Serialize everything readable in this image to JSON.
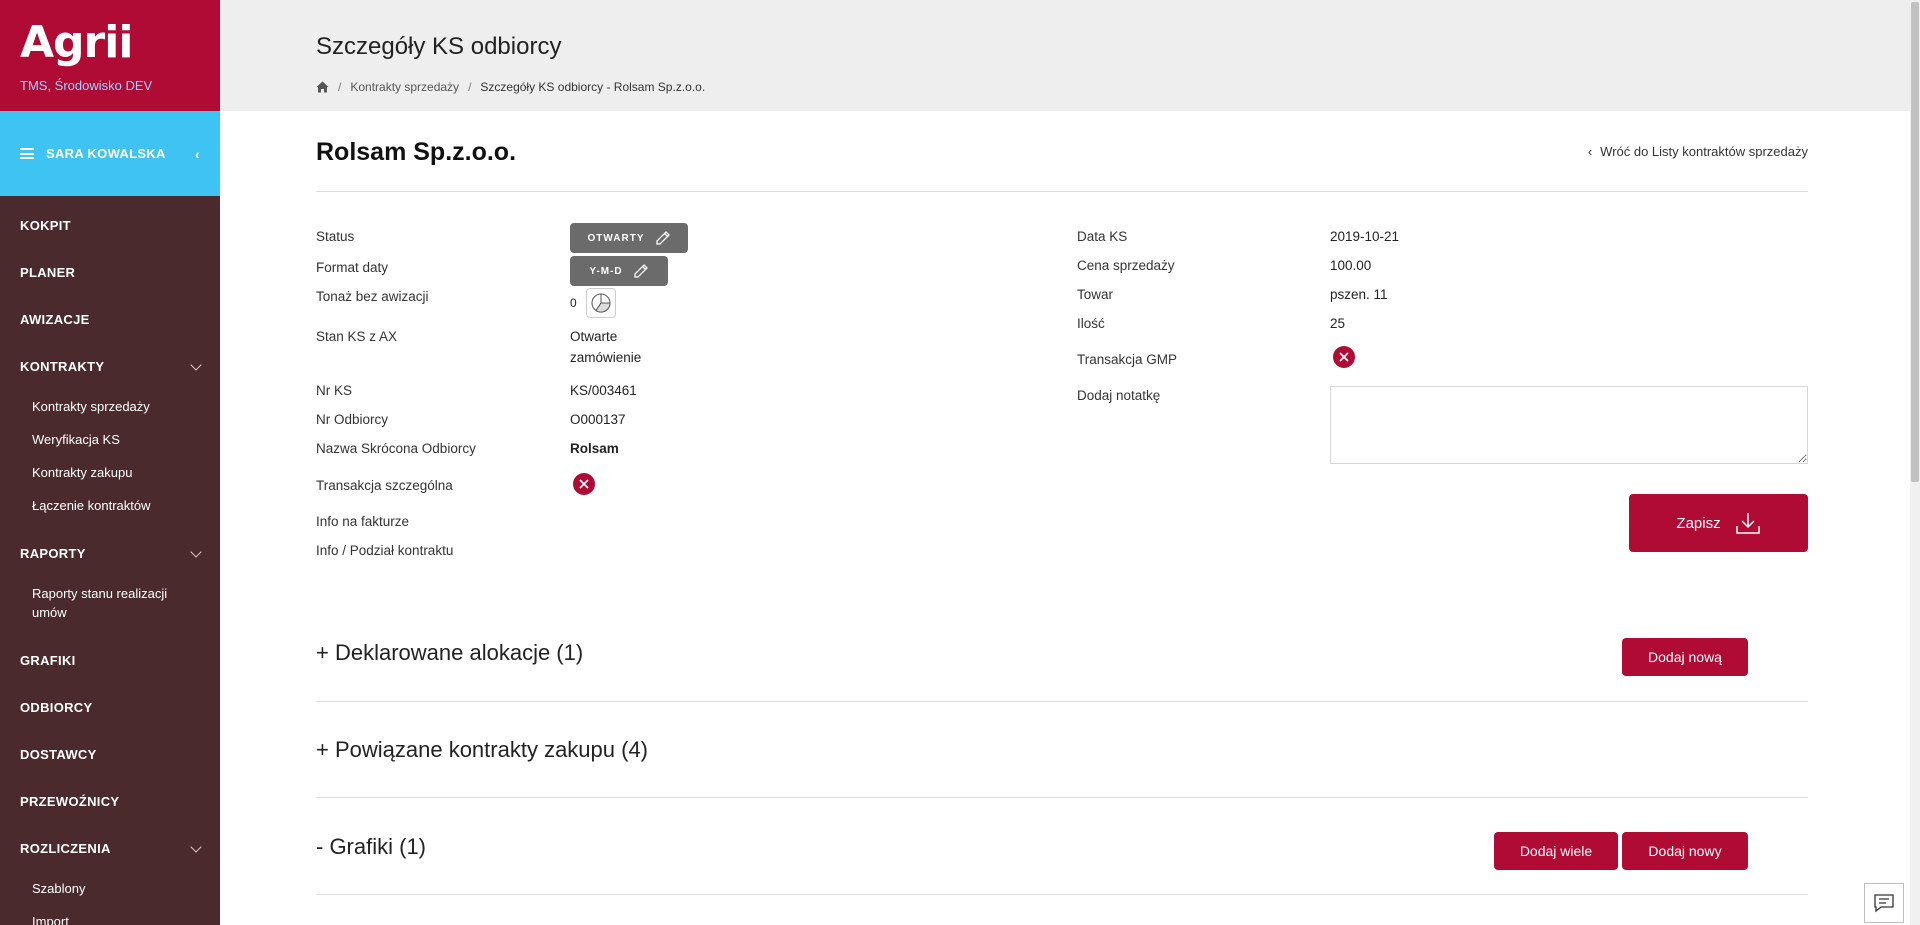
{
  "sidebar": {
    "logo": "Agrii",
    "environment": "TMS, Środowisko DEV",
    "user_name": "SARA KOWALSKA",
    "collapse_glyph": "‹",
    "nav": {
      "kokpit": "KOKPIT",
      "planer": "PLANER",
      "awizacje": "AWIZACJE",
      "kontrakty": "KONTRAKTY",
      "kontrakty_sub": [
        "Kontrakty sprzedaży",
        "Weryfikacja KS",
        "Kontrakty zakupu",
        "Łączenie kontraktów"
      ],
      "raporty": "RAPORTY",
      "raporty_sub": [
        "Raporty stanu realizacji umów"
      ],
      "grafiki": "GRAFIKI",
      "odbiorcy": "ODBIORCY",
      "dostawcy": "DOSTAWCY",
      "przewoznicy": "PRZEWOŹNICY",
      "rozliczenia": "ROZLICZENIA",
      "rozliczenia_sub": [
        "Szablony",
        "Import"
      ]
    }
  },
  "header": {
    "title": "Szczegóły KS odbiorcy",
    "breadcrumb": {
      "item1": "Kontrakty sprzedaży",
      "current": "Szczegóły KS odbiorcy - Rolsam Sp.z.o.o.",
      "separator": "/"
    }
  },
  "record": {
    "title": "Rolsam Sp.z.o.o.",
    "back_link": "Wróć do Listy kontraktów sprzedaży"
  },
  "left_fields": {
    "status_label": "Status",
    "status_value": "OTWARTY",
    "date_format_label": "Format daty",
    "date_format_value": "Y-M-D",
    "tonnage_label": "Tonaż bez awizacji",
    "tonnage_value": "0",
    "stan_label": "Stan KS z AX",
    "stan_value_line1": "Otwarte",
    "stan_value_line2": "zamówienie",
    "nr_ks_label": "Nr KS",
    "nr_ks_value": "KS/003461",
    "nr_odbiorcy_label": "Nr Odbiorcy",
    "nr_odbiorcy_value": "O000137",
    "nazwa_label": "Nazwa Skrócona Odbiorcy",
    "nazwa_value": "Rolsam",
    "transakcja_szczegolna_label": "Transakcja szczególna",
    "info_faktura_label": "Info na fakturze",
    "info_podzial_label": "Info / Podział kontraktu"
  },
  "right_fields": {
    "data_ks_label": "Data KS",
    "data_ks_value": "2019-10-21",
    "cena_label": "Cena sprzedaży",
    "cena_value": "100.00",
    "towar_label": "Towar",
    "towar_value": "pszen. 11",
    "ilosc_label": "Ilość",
    "ilosc_value": "25",
    "gmp_label": "Transakcja GMP",
    "notatka_label": "Dodaj notatkę"
  },
  "buttons": {
    "save": "Zapisz",
    "add_new_f": "Dodaj nową",
    "add_many": "Dodaj wiele",
    "add_new_m": "Dodaj nowy"
  },
  "sections": {
    "allocations": "+ Deklarowane alokacje (1)",
    "purchase_contracts": "+ Powiązane kontrakty zakupu (4)",
    "schedules": "- Grafiki (1)"
  },
  "colors": {
    "brand": "#b00b34",
    "sidebar_bg": "#4a2a2c",
    "user_bar": "#3fc3f2",
    "pill": "#6b6b6b"
  },
  "icons": [
    "home-icon",
    "pencil-icon",
    "pie-chart-icon",
    "x-circle-icon",
    "download-icon",
    "hamburger-icon",
    "chevron-down-icon",
    "chevron-left-icon",
    "chat-icon"
  ]
}
